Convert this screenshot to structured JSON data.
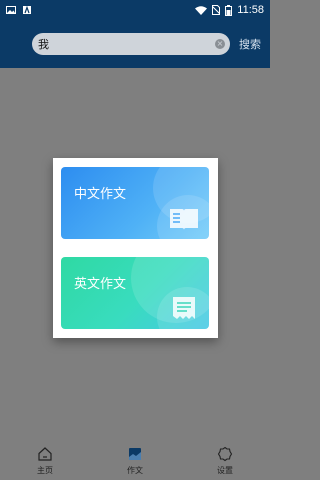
{
  "status": {
    "time": "11:58"
  },
  "search": {
    "value": "我",
    "button_label": "搜索"
  },
  "cards": [
    {
      "title": "中文作文",
      "icon": "book-icon"
    },
    {
      "title": "英文作文",
      "icon": "document-icon"
    }
  ],
  "nav": [
    {
      "label": "主页",
      "icon": "home-icon"
    },
    {
      "label": "作文",
      "icon": "essay-icon"
    },
    {
      "label": "设置",
      "icon": "settings-icon"
    }
  ],
  "colors": {
    "header": "#0b3a66",
    "overlay": "#7f7f7f",
    "card_cn": "#3a9df3",
    "card_en": "#34dbb5"
  }
}
